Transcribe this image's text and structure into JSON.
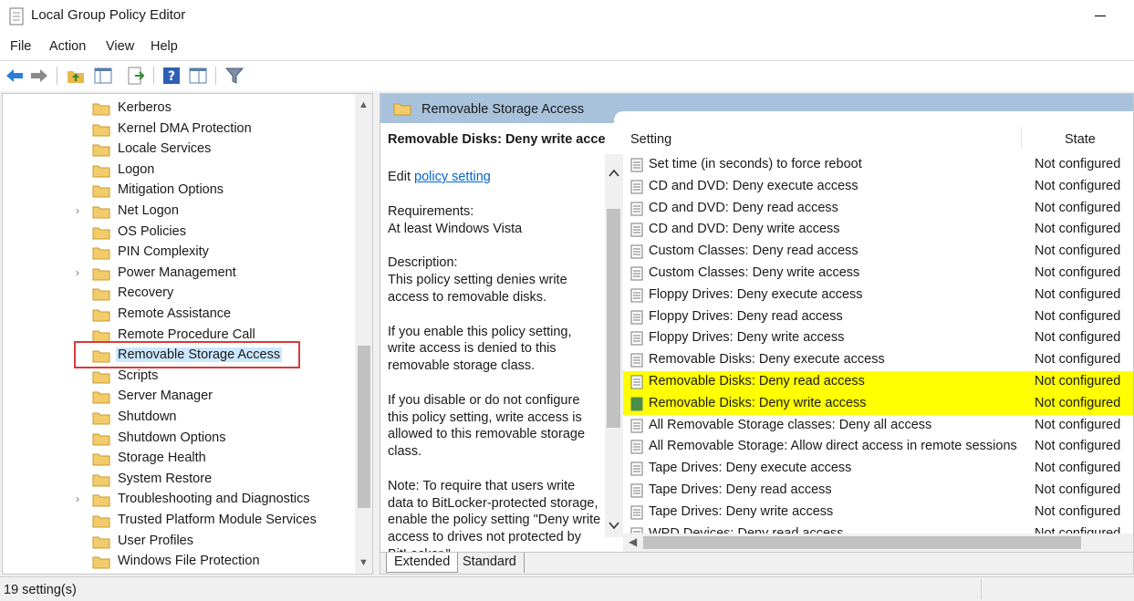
{
  "window": {
    "title": "Local Group Policy Editor"
  },
  "menu": [
    "File",
    "Action",
    "View",
    "Help"
  ],
  "toolbar_icons": [
    "back-arrow-icon",
    "forward-arrow-icon",
    "up-folder-icon",
    "show-hide-tree-icon",
    "export-list-icon",
    "help-icon",
    "properties-pane-icon",
    "filter-icon"
  ],
  "tree": {
    "items": [
      {
        "label": "Kerberos",
        "expandable": false
      },
      {
        "label": "Kernel DMA Protection",
        "expandable": false
      },
      {
        "label": "Locale Services",
        "expandable": false
      },
      {
        "label": "Logon",
        "expandable": false
      },
      {
        "label": "Mitigation Options",
        "expandable": false
      },
      {
        "label": "Net Logon",
        "expandable": true
      },
      {
        "label": "OS Policies",
        "expandable": false
      },
      {
        "label": "PIN Complexity",
        "expandable": false
      },
      {
        "label": "Power Management",
        "expandable": true
      },
      {
        "label": "Recovery",
        "expandable": false
      },
      {
        "label": "Remote Assistance",
        "expandable": false
      },
      {
        "label": "Remote Procedure Call",
        "expandable": false
      },
      {
        "label": "Removable Storage Access",
        "expandable": false,
        "selected": true
      },
      {
        "label": "Scripts",
        "expandable": false
      },
      {
        "label": "Server Manager",
        "expandable": false
      },
      {
        "label": "Shutdown",
        "expandable": false
      },
      {
        "label": "Shutdown Options",
        "expandable": false
      },
      {
        "label": "Storage Health",
        "expandable": false
      },
      {
        "label": "System Restore",
        "expandable": false
      },
      {
        "label": "Troubleshooting and Diagnostics",
        "expandable": true
      },
      {
        "label": "Trusted Platform Module Services",
        "expandable": false
      },
      {
        "label": "User Profiles",
        "expandable": false
      },
      {
        "label": "Windows File Protection",
        "expandable": false
      }
    ]
  },
  "panel": {
    "header": "Removable Storage Access",
    "description": {
      "title": "Removable Disks: Deny write access",
      "edit_prefix": "Edit ",
      "edit_link": "policy setting ",
      "body": "Requirements:\nAt least Windows Vista\n\nDescription:\nThis policy setting denies write access to removable disks.\n\nIf you enable this policy setting, write access is denied to this removable storage class.\n\nIf you disable or do not configure this policy setting, write access is allowed to this removable storage class.\n\nNote: To require that users write data to BitLocker-protected storage, enable the policy setting \"Deny write access to drives not protected by BitLocker,\""
    },
    "list": {
      "col_setting": "Setting",
      "col_state": "State",
      "rows": [
        {
          "name": "Set time (in seconds) to force reboot",
          "state": "Not configured"
        },
        {
          "name": "CD and DVD: Deny execute access",
          "state": "Not configured"
        },
        {
          "name": "CD and DVD: Deny read access",
          "state": "Not configured"
        },
        {
          "name": "CD and DVD: Deny write access",
          "state": "Not configured"
        },
        {
          "name": "Custom Classes: Deny read access",
          "state": "Not configured"
        },
        {
          "name": "Custom Classes: Deny write access",
          "state": "Not configured"
        },
        {
          "name": "Floppy Drives: Deny execute access",
          "state": "Not configured"
        },
        {
          "name": "Floppy Drives: Deny read access",
          "state": "Not configured"
        },
        {
          "name": "Floppy Drives: Deny write access",
          "state": "Not configured"
        },
        {
          "name": "Removable Disks: Deny execute access",
          "state": "Not configured"
        },
        {
          "name": "Removable Disks: Deny read access",
          "state": "Not configured",
          "highlight": true
        },
        {
          "name": "Removable Disks: Deny write access",
          "state": "Not configured",
          "highlight": true,
          "selected": true
        },
        {
          "name": "All Removable Storage classes: Deny all access",
          "state": "Not configured"
        },
        {
          "name": "All Removable Storage: Allow direct access in remote sessions",
          "state": "Not configured"
        },
        {
          "name": "Tape Drives: Deny execute access",
          "state": "Not configured"
        },
        {
          "name": "Tape Drives: Deny read access",
          "state": "Not configured"
        },
        {
          "name": "Tape Drives: Deny write access",
          "state": "Not configured"
        },
        {
          "name": "WPD Devices: Deny read access",
          "state": "Not configured"
        }
      ]
    },
    "tabs": [
      "Extended",
      "Standard"
    ]
  },
  "status": {
    "text": "19 setting(s)"
  },
  "colors": {
    "highlight": "#ffff00",
    "selection_box": "#d93a3a",
    "header_band": "#a9c2dc",
    "link": "#0066cc"
  }
}
